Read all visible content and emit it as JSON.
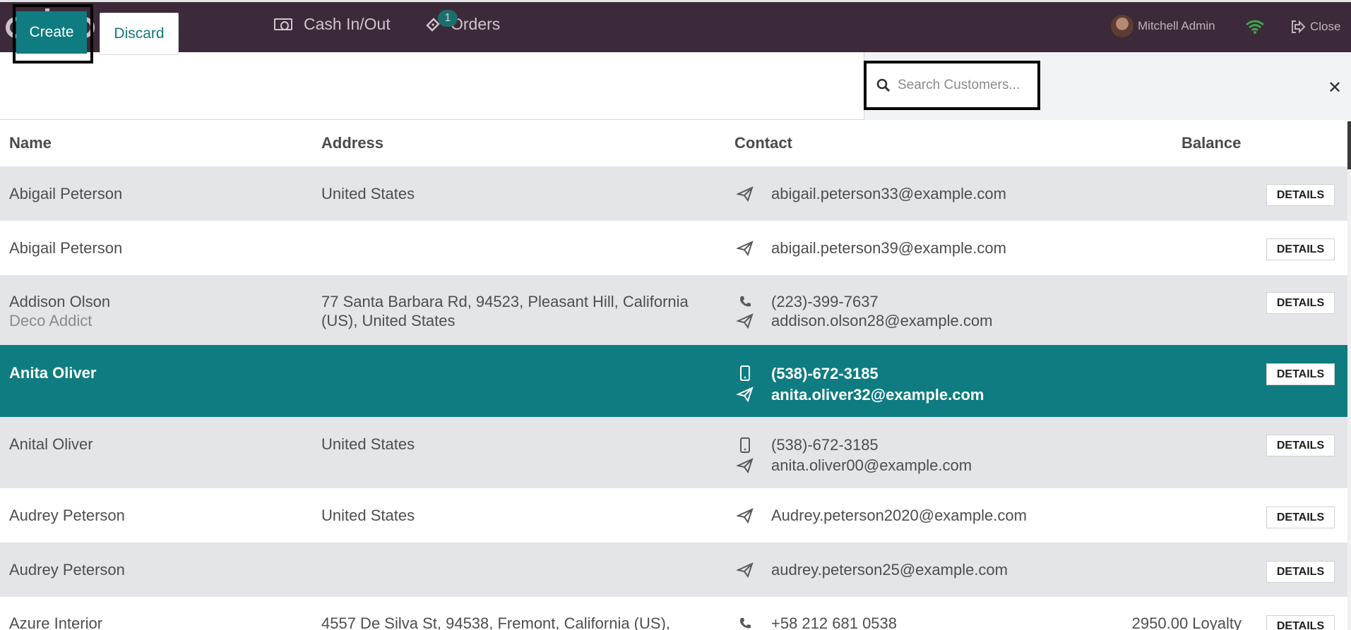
{
  "topbar": {
    "cash_label": "Cash In/Out",
    "orders_label": "Orders",
    "orders_badge": "1",
    "user_name": "Mitchell Admin",
    "close_label": "Close"
  },
  "controls": {
    "create_label": "Create",
    "discard_label": "Discard",
    "search_placeholder": "Search Customers..."
  },
  "table": {
    "headers": {
      "name": "Name",
      "address": "Address",
      "contact": "Contact",
      "balance": "Balance"
    },
    "details_label": "DETAILS",
    "rows": [
      {
        "name": "Abigail Peterson",
        "company": "",
        "address": "United States",
        "phone": "",
        "email": "abigail.peterson33@example.com",
        "balance": ""
      },
      {
        "name": "Abigail Peterson",
        "company": "",
        "address": "",
        "phone": "",
        "email": "abigail.peterson39@example.com",
        "balance": ""
      },
      {
        "name": "Addison Olson",
        "company": "Deco Addict",
        "address": "77 Santa Barbara Rd, 94523, Pleasant Hill, California (US), United States",
        "phone": "(223)-399-7637",
        "email": "addison.olson28@example.com",
        "balance": ""
      },
      {
        "name": "Anita Oliver",
        "company": "",
        "address": "",
        "phone": "(538)-672-3185",
        "email": "anita.oliver32@example.com",
        "balance": ""
      },
      {
        "name": "Anital Oliver",
        "company": "",
        "address": "United States",
        "phone": "(538)-672-3185",
        "email": "anita.oliver00@example.com",
        "balance": ""
      },
      {
        "name": "Audrey Peterson",
        "company": "",
        "address": "United States",
        "phone": "",
        "email": "Audrey.peterson2020@example.com",
        "balance": ""
      },
      {
        "name": "Audrey Peterson",
        "company": "",
        "address": "",
        "phone": "",
        "email": "audrey.peterson25@example.com",
        "balance": ""
      },
      {
        "name": "Azure Interior",
        "company": "",
        "address": "4557 De Silva St, 94538, Fremont, California (US),",
        "phone": "+58 212 681 0538",
        "email": "",
        "balance": "2950.00 Loyalty"
      }
    ]
  }
}
